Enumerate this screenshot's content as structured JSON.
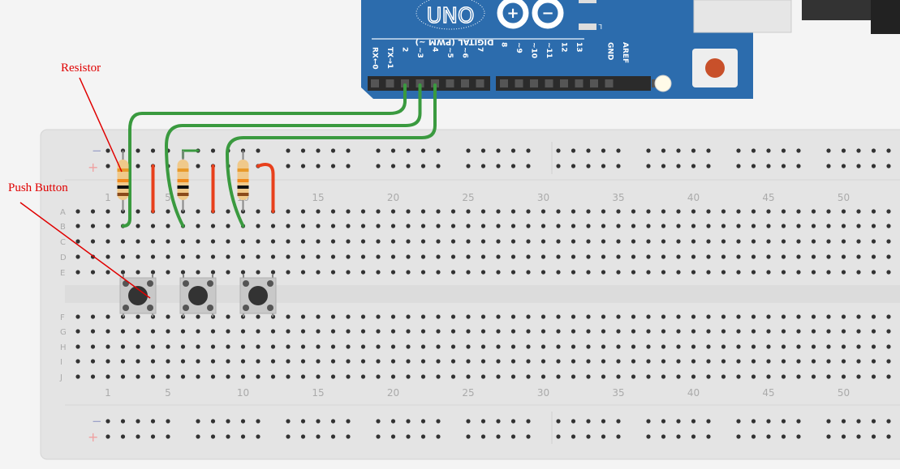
{
  "annotations": {
    "resistor": "Resistor",
    "push_button": "Push Button"
  },
  "arduino": {
    "model_label": "UNO",
    "digital_label": "DIGITAL (PWM ~)",
    "led_label": "L",
    "pins_left": [
      "RX←0",
      "TX→1",
      "2",
      "~3",
      "4",
      "~5",
      "~6",
      "7"
    ],
    "pins_right": [
      "8",
      "~9",
      "~10",
      "~11",
      "12",
      "13",
      "GND",
      "AREF"
    ],
    "board_color": "#2c6cad"
  },
  "breadboard": {
    "rows_top": [
      "A",
      "B",
      "C",
      "D",
      "E"
    ],
    "rows_bottom": [
      "F",
      "G",
      "H",
      "I",
      "J"
    ],
    "column_labels": [
      "1",
      "5",
      "10",
      "15",
      "20",
      "25",
      "30",
      "35",
      "40",
      "45",
      "50"
    ],
    "rail_minus": "−",
    "rail_plus": "+"
  },
  "colors": {
    "wire_green": "#3a9a3f",
    "wire_red": "#e8401c",
    "annotation": "#e00000"
  }
}
